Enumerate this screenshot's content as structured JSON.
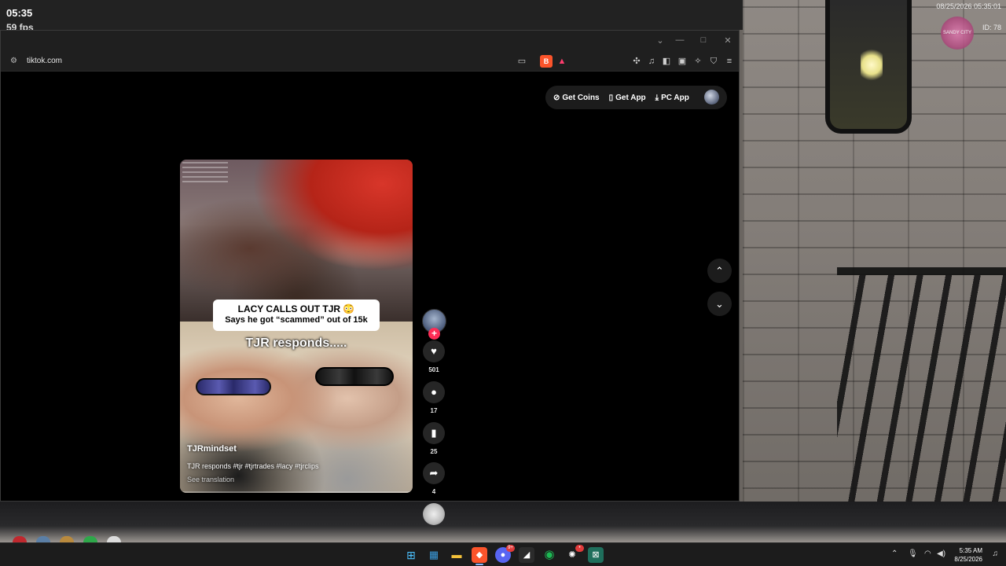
{
  "hud": {
    "time": "05:35",
    "fps": "59 fps",
    "datetime": "08/25/2026 05:35:01",
    "id": "ID: 78",
    "logo_text": "SANDY CITY"
  },
  "browser": {
    "url": "tiktok.com",
    "window_controls": {
      "chevron": "⌄",
      "minimize": "—",
      "maximize": "□",
      "close": "✕"
    }
  },
  "tiktok": {
    "header_buttons": [
      {
        "label": "Get Coins",
        "icon": "coin-icon"
      },
      {
        "label": "Get App",
        "icon": "phone-icon"
      },
      {
        "label": "PC App",
        "icon": "download-icon"
      }
    ],
    "video": {
      "caption_line1": "LACY CALLS OUT TJR 😳",
      "caption_line2": "Says he got “scammed” out of 15k",
      "overlay_text": "TJR responds.....",
      "author": "TJRmindset",
      "description": "TJR responds #tjr #tjrtrades #lacy #tjrclips",
      "see_translation": "See translation"
    },
    "actions": {
      "likes": "501",
      "comments": "17",
      "saves": "25",
      "shares": "4"
    }
  },
  "taskbar": {
    "apps": [
      {
        "name": "windows-start",
        "glyph": "⊞",
        "color": "#4cc2ff"
      },
      {
        "name": "microsoft-store",
        "glyph": "▦",
        "color": "#3a9bdc"
      },
      {
        "name": "file-explorer",
        "glyph": "▬",
        "color": "#f3c13a"
      },
      {
        "name": "brave-browser",
        "glyph": "◆",
        "color": "#fb542b"
      },
      {
        "name": "discord",
        "glyph": "●",
        "color": "#5865f2",
        "badge": "9+"
      },
      {
        "name": "app-launcher",
        "glyph": "◢",
        "color": "#2b2b2b"
      },
      {
        "name": "spotify",
        "glyph": "◉",
        "color": "#1db954"
      },
      {
        "name": "chatgpt",
        "glyph": "✺",
        "color": "#2b2b2b",
        "badge": "•"
      },
      {
        "name": "terminal-app",
        "glyph": "⊠",
        "color": "#1f6f5c"
      }
    ],
    "time": "5:35 AM",
    "date": "8/25/2026"
  }
}
